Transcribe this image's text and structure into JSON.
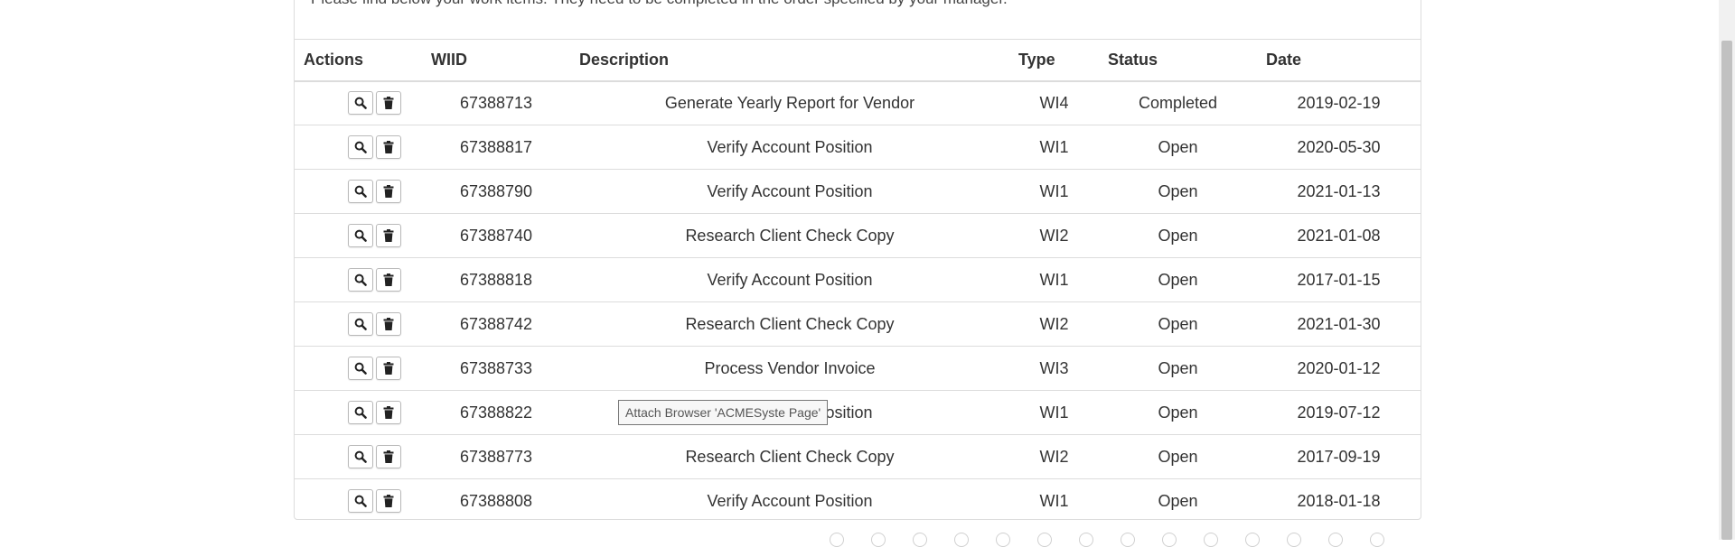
{
  "intro_text": "Please find below your work items. They need to be completed in the order specified by your manager.",
  "columns": {
    "actions": "Actions",
    "wiid": "WIID",
    "description": "Description",
    "type": "Type",
    "status": "Status",
    "date": "Date"
  },
  "rows": [
    {
      "wiid": "67388713",
      "description": "Generate Yearly Report for Vendor",
      "type": "WI4",
      "status": "Completed",
      "date": "2019-02-19"
    },
    {
      "wiid": "67388817",
      "description": "Verify Account Position",
      "type": "WI1",
      "status": "Open",
      "date": "2020-05-30"
    },
    {
      "wiid": "67388790",
      "description": "Verify Account Position",
      "type": "WI1",
      "status": "Open",
      "date": "2021-01-13"
    },
    {
      "wiid": "67388740",
      "description": "Research Client Check Copy",
      "type": "WI2",
      "status": "Open",
      "date": "2021-01-08"
    },
    {
      "wiid": "67388818",
      "description": "Verify Account Position",
      "type": "WI1",
      "status": "Open",
      "date": "2017-01-15"
    },
    {
      "wiid": "67388742",
      "description": "Research Client Check Copy",
      "type": "WI2",
      "status": "Open",
      "date": "2021-01-30"
    },
    {
      "wiid": "67388733",
      "description": "Process Vendor Invoice",
      "type": "WI3",
      "status": "Open",
      "date": "2020-01-12"
    },
    {
      "wiid": "67388822",
      "description": "Verify Account Position",
      "type": "WI1",
      "status": "Open",
      "date": "2019-07-12"
    },
    {
      "wiid": "67388773",
      "description": "Research Client Check Copy",
      "type": "WI2",
      "status": "Open",
      "date": "2017-09-19"
    },
    {
      "wiid": "67388808",
      "description": "Verify Account Position",
      "type": "WI1",
      "status": "Open",
      "date": "2018-01-18"
    }
  ],
  "row_actions": [
    "search-icon",
    "trash-icon"
  ],
  "tooltip": "Attach Browser 'ACMESyste Page'"
}
